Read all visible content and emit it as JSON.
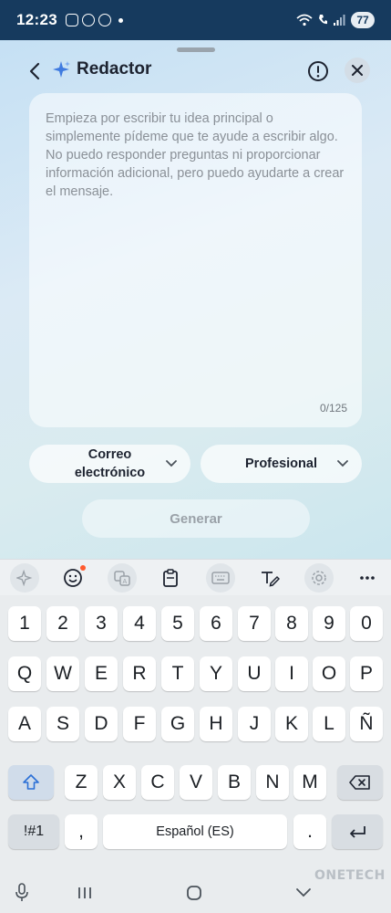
{
  "status_bar": {
    "time": "12:23",
    "battery": "77"
  },
  "header": {
    "title": "Redactor",
    "back_icon": "chevron-left-icon",
    "info_icon": "exclamation-circle-icon",
    "close_icon": "close-icon"
  },
  "editor": {
    "placeholder": "Empieza por escribir tu idea principal o simplemente pídeme que te ayude a escribir algo. No puedo responder preguntas ni proporcionar información adicional, pero puedo ayudarte a crear el mensaje.",
    "counter": "0/125"
  },
  "options": {
    "format_line1": "Correo",
    "format_line2": "electrónico",
    "tone": "Profesional"
  },
  "generate_label": "Generar",
  "keyboard": {
    "row_numbers": [
      "1",
      "2",
      "3",
      "4",
      "5",
      "6",
      "7",
      "8",
      "9",
      "0"
    ],
    "row_q": [
      "Q",
      "W",
      "E",
      "R",
      "T",
      "Y",
      "U",
      "I",
      "O",
      "P"
    ],
    "row_a": [
      "A",
      "S",
      "D",
      "F",
      "G",
      "H",
      "J",
      "K",
      "L",
      "Ñ"
    ],
    "row_z": [
      "Z",
      "X",
      "C",
      "V",
      "B",
      "N",
      "M"
    ],
    "symbols_label": "!#1",
    "comma": ",",
    "space_label": "Español (ES)",
    "period": "."
  },
  "watermark": "ONETECH",
  "colors": {
    "status_bar": "#163a5e",
    "notification_dot": "#ff5a2e"
  }
}
